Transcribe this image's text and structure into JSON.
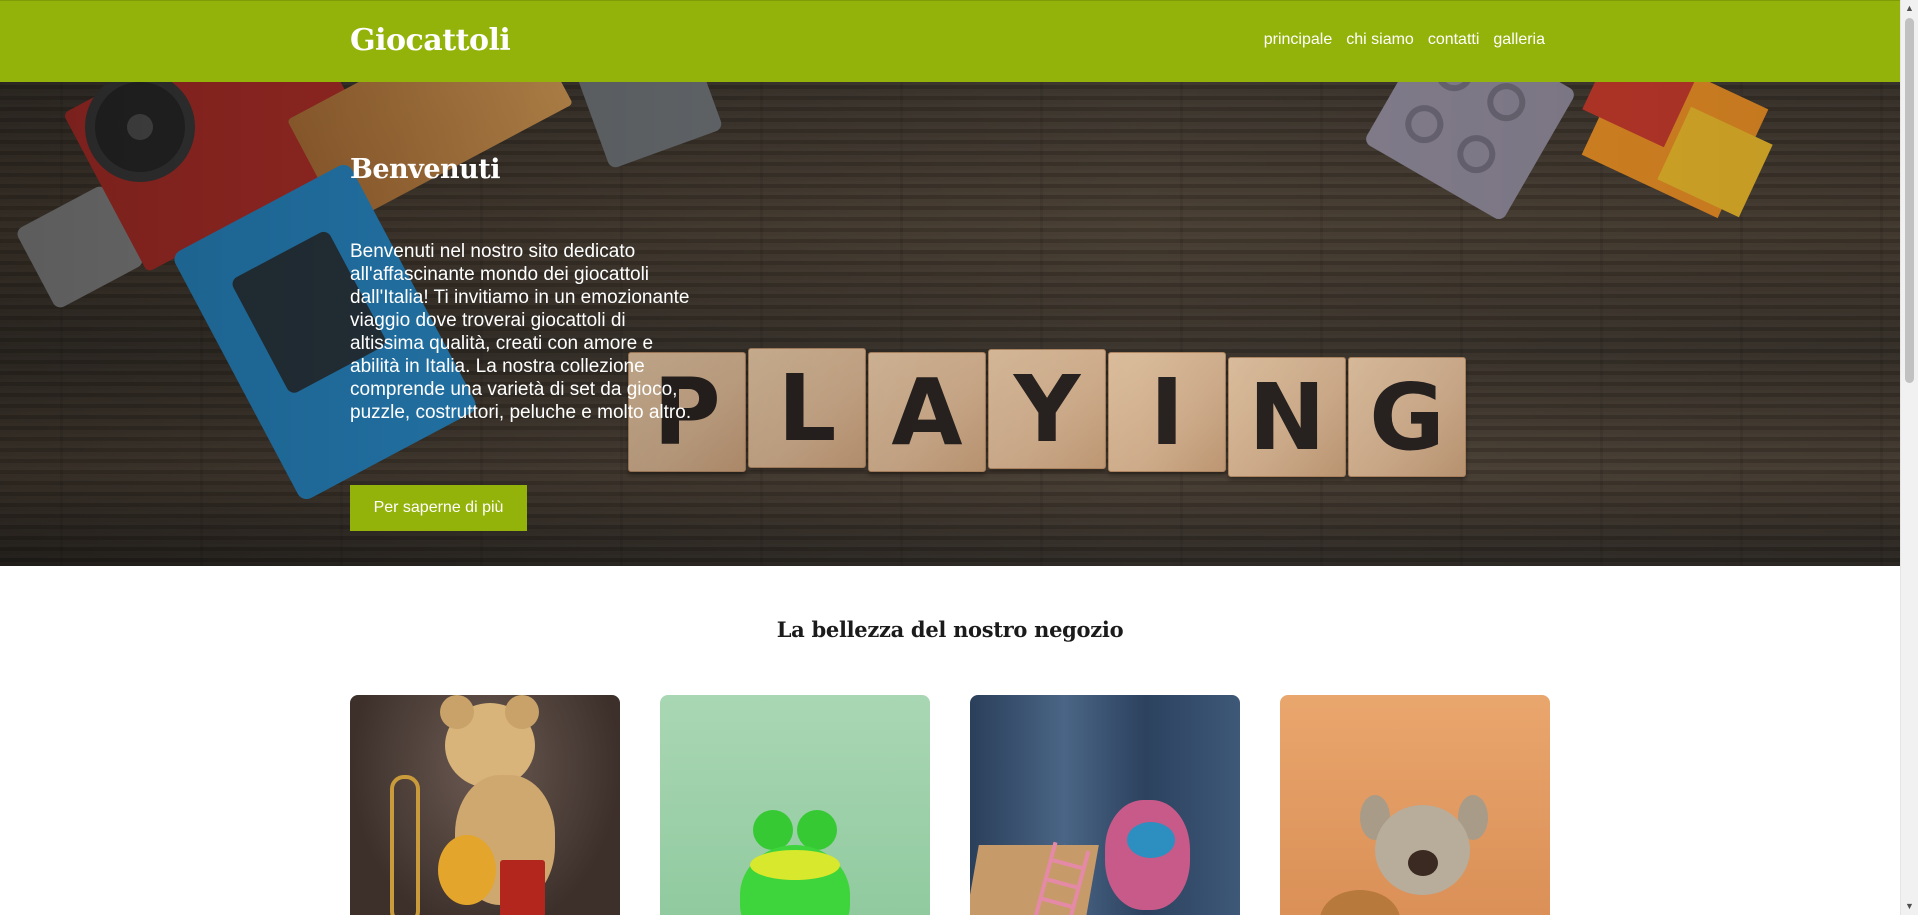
{
  "header": {
    "logo": "Giocattoli",
    "nav": [
      "principale",
      "chi siamo",
      "contatti",
      "galleria"
    ]
  },
  "hero": {
    "title": "Benvenuti",
    "text": "Benvenuti nel nostro sito dedicato all'affascinante mondo dei giocattoli dall'Italia! Ti invitiamo in un emozionante viaggio dove troverai giocattoli di altissima qualità, creati con amore e abilità in Italia. La nostra collezione comprende una varietà di set da gioco, puzzle, costruttori, peluche e molto altro.",
    "button_label": "Per saperne di più",
    "tiles": [
      "P",
      "L",
      "A",
      "Y",
      "I",
      "N",
      "G"
    ]
  },
  "gallery": {
    "title": "La bellezza del nostro negozio"
  },
  "colors": {
    "accent": "#93b30a"
  },
  "scrollbar": {
    "up_icon": "▲",
    "down_icon": "▼"
  }
}
